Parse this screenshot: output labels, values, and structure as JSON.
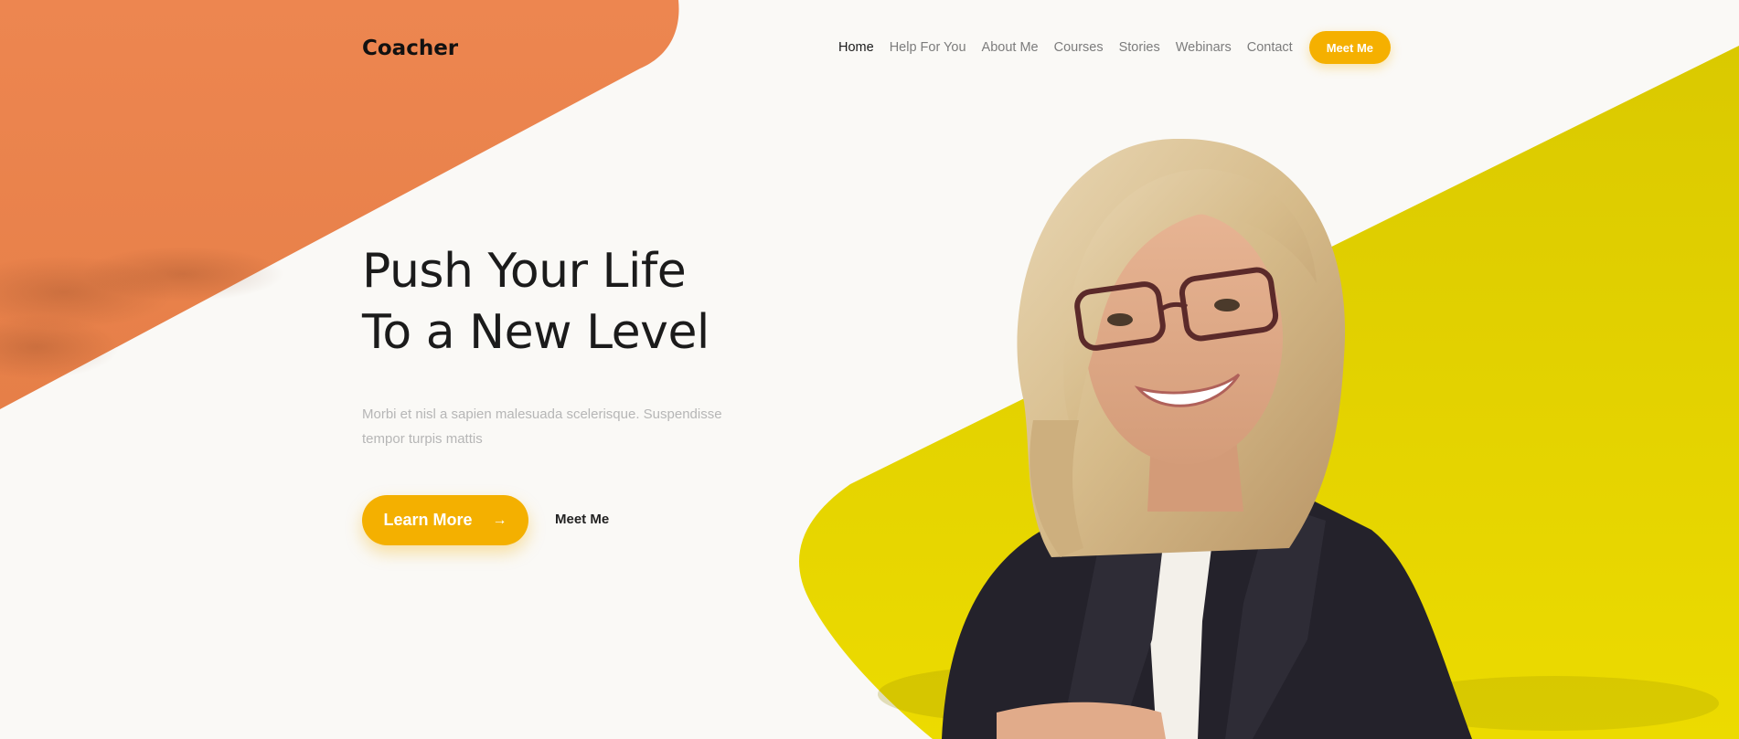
{
  "brand": {
    "logo_text": "Coacher"
  },
  "nav": {
    "items": [
      {
        "label": "Home",
        "active": true
      },
      {
        "label": "Help For You",
        "active": false
      },
      {
        "label": "About Me",
        "active": false
      },
      {
        "label": "Courses",
        "active": false
      },
      {
        "label": "Stories",
        "active": false
      },
      {
        "label": "Webinars",
        "active": false
      },
      {
        "label": "Contact",
        "active": false
      }
    ],
    "cta_label": "Meet Me"
  },
  "hero": {
    "title_line1": "Push Your Life",
    "title_line2": "To a New Level",
    "description": "Morbi et nisl a sapien malesuada scelerisque. Suspendisse tempor turpis mattis",
    "primary_button_label": "Learn More",
    "primary_button_icon": "arrow-right-icon",
    "secondary_button_label": "Meet Me"
  },
  "colors": {
    "accent": "#f4b000",
    "orange_shape": "#ec844f",
    "yellow_shape": "#e7d500",
    "background": "#faf9f6",
    "heading": "#1b1b1b",
    "muted_text": "#b6b6b6"
  }
}
